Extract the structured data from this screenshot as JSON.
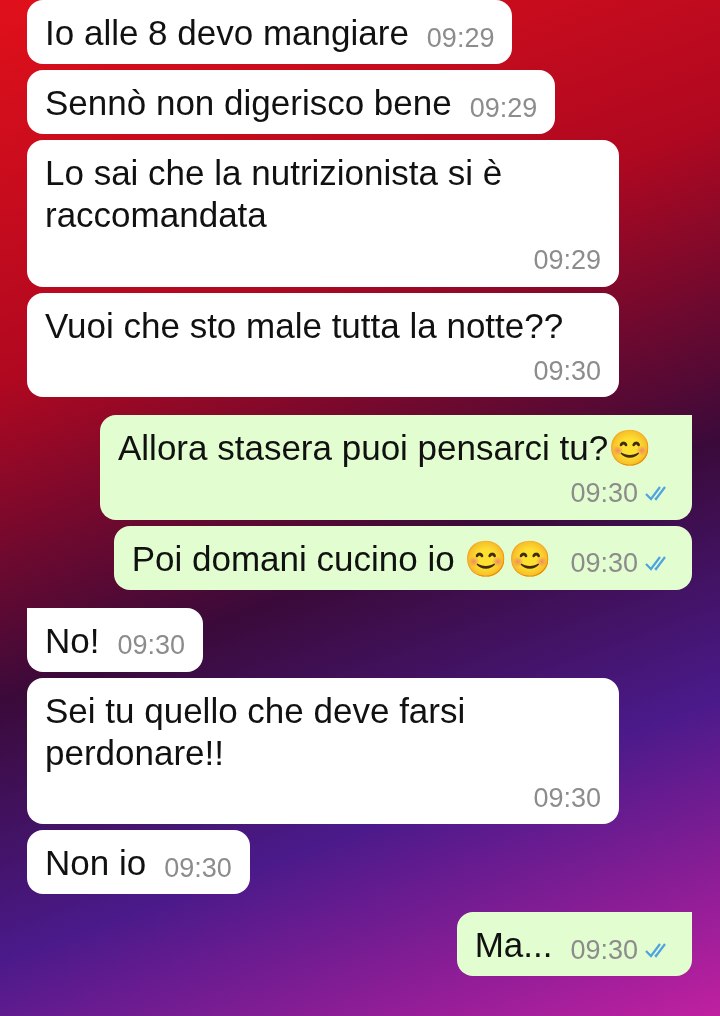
{
  "messages": [
    {
      "kind": "received",
      "text": "Io alle 8 devo mangiare",
      "time": "09:29"
    },
    {
      "kind": "received",
      "text": "Sennò non digerisco bene",
      "time": "09:29"
    },
    {
      "kind": "received",
      "text": "Lo sai che la nutrizionista si è raccomandata",
      "time": "09:29"
    },
    {
      "kind": "received",
      "text": "Vuoi che sto male tutta la notte??",
      "time": "09:30"
    },
    {
      "kind": "sent",
      "text": "Allora stasera puoi pensarci tu?😊",
      "time": "09:30",
      "read": true
    },
    {
      "kind": "sent",
      "text": "Poi domani cucino io 😊😊",
      "time": "09:30",
      "read": true
    },
    {
      "kind": "received",
      "text": "No!",
      "time": "09:30"
    },
    {
      "kind": "received",
      "text": "Sei tu quello che deve farsi perdonare!!",
      "time": "09:30"
    },
    {
      "kind": "received",
      "text": "Non io",
      "time": "09:30"
    },
    {
      "kind": "sent",
      "text": "Ma...",
      "time": "09:30",
      "read": true
    }
  ]
}
